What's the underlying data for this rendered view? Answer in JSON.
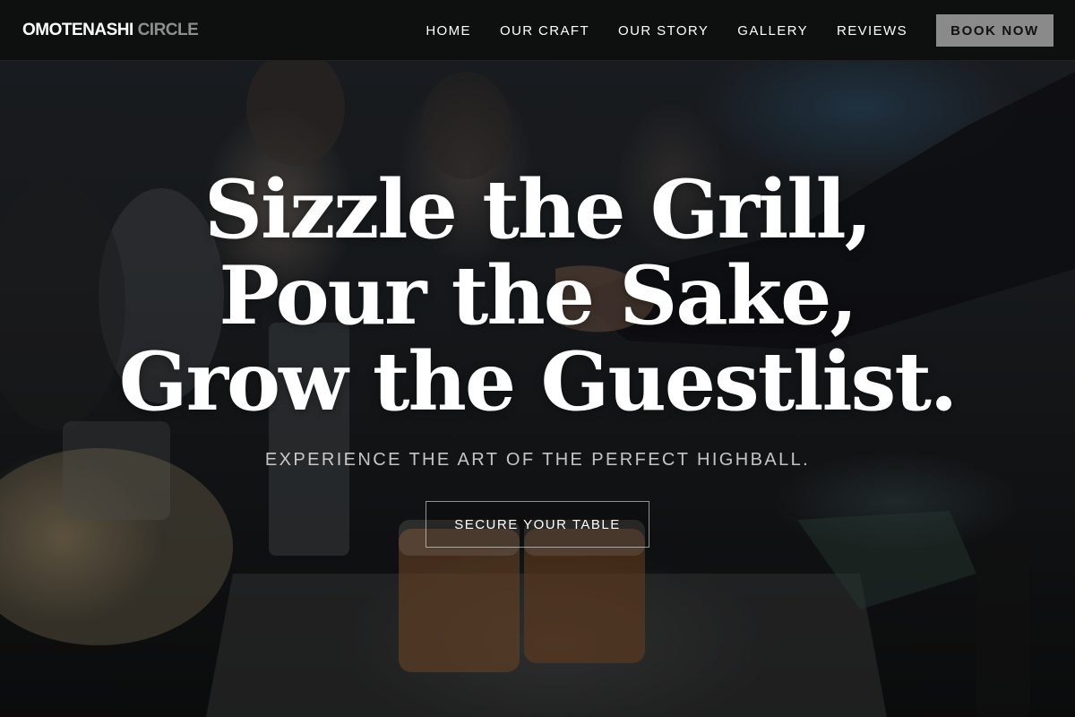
{
  "brand": {
    "primary": "OMOTENASHI",
    "secondary": "CIRCLE"
  },
  "nav": {
    "items": [
      {
        "label": "HOME"
      },
      {
        "label": "OUR CRAFT"
      },
      {
        "label": "OUR STORY"
      },
      {
        "label": "GALLERY"
      },
      {
        "label": "REVIEWS"
      }
    ],
    "cta_label": "BOOK NOW"
  },
  "hero": {
    "title_lines": [
      "Sizzle the Grill,",
      "Pour the Sake,",
      "Grow the Guestlist."
    ],
    "subtitle": "EXPERIENCE THE ART OF THE PERFECT HIGHBALL.",
    "cta_label": "SECURE YOUR TABLE",
    "background_image": "bartender-pouring-drinks-icon"
  },
  "colors": {
    "navbar_bg": "#0e0e0e",
    "book_button_bg": "#8a8a8a",
    "text_primary": "#ffffff",
    "logo_secondary": "#8e8e8e"
  }
}
